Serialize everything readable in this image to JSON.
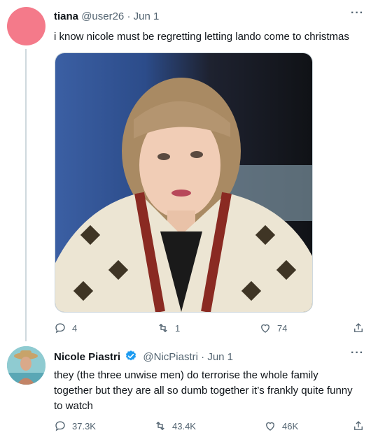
{
  "tweet1": {
    "name": "tiana",
    "handle": "@user26",
    "dot": "·",
    "date": "Jun 1",
    "text": "i know nicole must be regretting letting lando come to christmas",
    "avatar_color": "#f47a8a",
    "stats": {
      "replies": "4",
      "retweets": "1",
      "likes": "74"
    }
  },
  "tweet2": {
    "name": "Nicole Piastri",
    "handle": "@NicPiastri",
    "dot": "·",
    "date": "Jun 1",
    "text": "they (the three unwise men) do terrorise the whole family together but they are all so dumb together it’s frankly quite funny to watch",
    "stats": {
      "replies": "37.3K",
      "retweets": "43.4K",
      "likes": "46K"
    }
  },
  "more_glyph": "···",
  "colors": {
    "verified": "#1d9bf0",
    "muted": "#536471",
    "line": "#cfd9de"
  }
}
